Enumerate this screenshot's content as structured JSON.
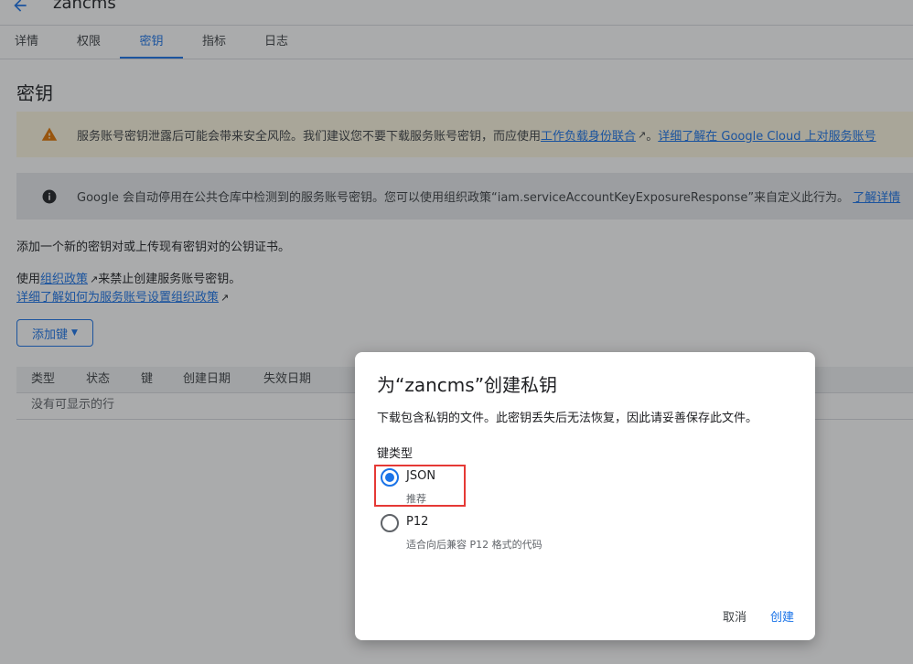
{
  "header": {
    "title": "zancms"
  },
  "tabs": [
    {
      "label": "详情"
    },
    {
      "label": "权限"
    },
    {
      "label": "密钥"
    },
    {
      "label": "指标"
    },
    {
      "label": "日志"
    }
  ],
  "page": {
    "heading": "密钥",
    "warning": {
      "text_before": "服务账号密钥泄露后可能会带来安全风险。我们建议您不要下载服务账号密钥，而应使用",
      "link1": "工作负载身份联合",
      "text_middle": "。",
      "link2": "详细了解在 Google Cloud 上对服务账号"
    },
    "info": {
      "text": "Google 会自动停用在公共仓库中检测到的服务账号密钥。您可以使用组织政策“iam.serviceAccountKeyExposureResponse”来自定义此行为。",
      "link": "了解详情"
    },
    "add_desc": "添加一个新的密钥对或上传现有密钥对的公钥证书。",
    "policy_prefix": "使用",
    "policy_link": "组织政策",
    "policy_suffix": "来禁止创建服务账号密钥。",
    "policy_learn_link": "详细了解如何为服务账号设置组织政策",
    "add_key_button": "添加键"
  },
  "table": {
    "headers": [
      "类型",
      "状态",
      "键",
      "创建日期",
      "失效日期"
    ],
    "empty_text": "没有可显示的行"
  },
  "dialog": {
    "title": "为“zancms”创建私钥",
    "description": "下载包含私钥的文件。此密钥丢失后无法恢复，因此请妥善保存此文件。",
    "key_type_label": "键类型",
    "options": [
      {
        "label": "JSON",
        "sublabel": "推荐",
        "selected": true
      },
      {
        "label": "P12",
        "sublabel": "适合向后兼容 P12 格式的代码",
        "selected": false
      }
    ],
    "cancel": "取消",
    "create": "创建"
  },
  "colors": {
    "accent": "#1a73e8",
    "warning_bg": "#fef7e0",
    "warning_icon": "#e37400",
    "highlight": "#e53935"
  }
}
